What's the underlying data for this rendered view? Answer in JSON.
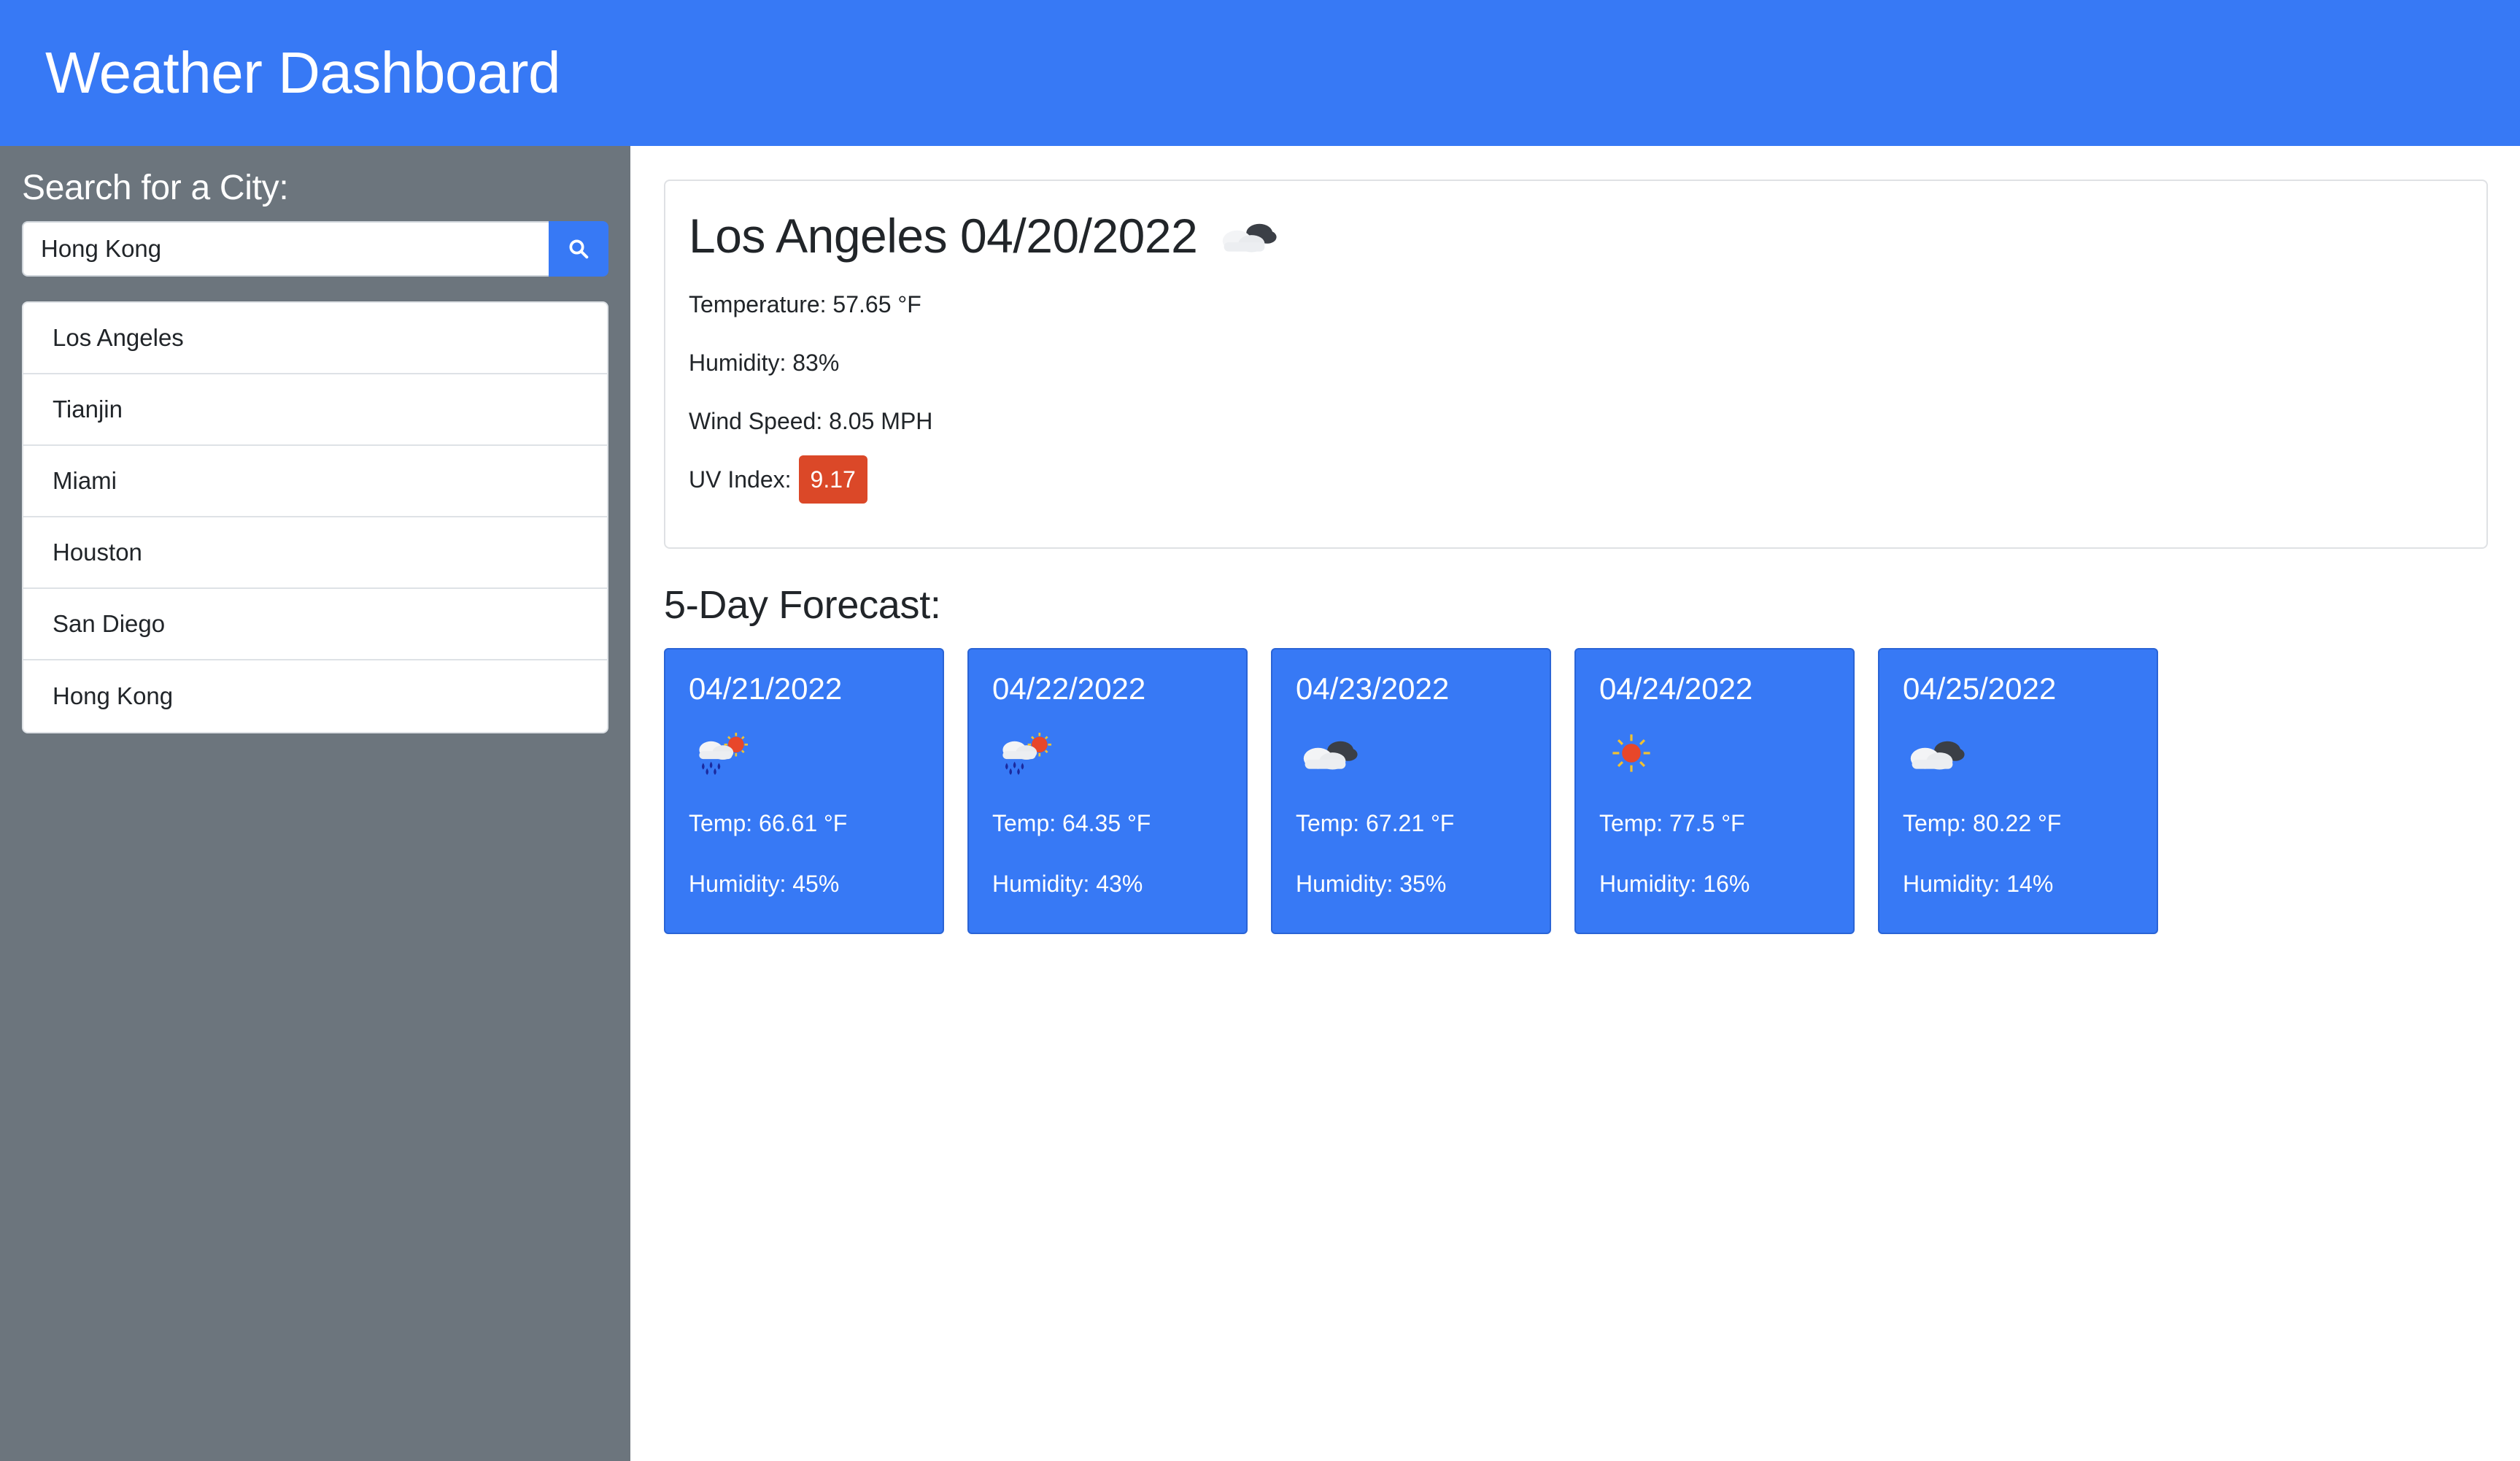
{
  "app": {
    "title": "Weather Dashboard"
  },
  "sidebar": {
    "title": "Search for a City:",
    "search": {
      "value": "Hong Kong",
      "placeholder": ""
    },
    "search_icon": "search-icon",
    "history": [
      "Los Angeles",
      "Tianjin",
      "Miami",
      "Houston",
      "San Diego",
      "Hong Kong"
    ]
  },
  "current": {
    "title": "Los Angeles 04/20/2022",
    "icon": "cloudy-icon",
    "temperature": "Temperature: 57.65 °F",
    "humidity": "Humidity: 83%",
    "wind": "Wind Speed: 8.05 MPH",
    "uv_label": "UV Index:",
    "uv_value": "9.17",
    "uv_color": "#db4828"
  },
  "forecast": {
    "title": "5-Day Forecast:",
    "days": [
      {
        "date": "04/21/2022",
        "icon": "rain-sun-icon",
        "temp": "Temp: 66.61 °F",
        "humidity": "Humidity: 45%"
      },
      {
        "date": "04/22/2022",
        "icon": "rain-sun-icon",
        "temp": "Temp: 64.35 °F",
        "humidity": "Humidity: 43%"
      },
      {
        "date": "04/23/2022",
        "icon": "cloudy-icon",
        "temp": "Temp: 67.21 °F",
        "humidity": "Humidity: 35%"
      },
      {
        "date": "04/24/2022",
        "icon": "sun-icon",
        "temp": "Temp: 77.5 °F",
        "humidity": "Humidity: 16%"
      },
      {
        "date": "04/25/2022",
        "icon": "cloudy-icon",
        "temp": "Temp: 80.22 °F",
        "humidity": "Humidity: 14%"
      }
    ]
  },
  "colors": {
    "primary": "#3779f5",
    "sidebar": "#6c757d",
    "uv_high": "#db4828"
  }
}
